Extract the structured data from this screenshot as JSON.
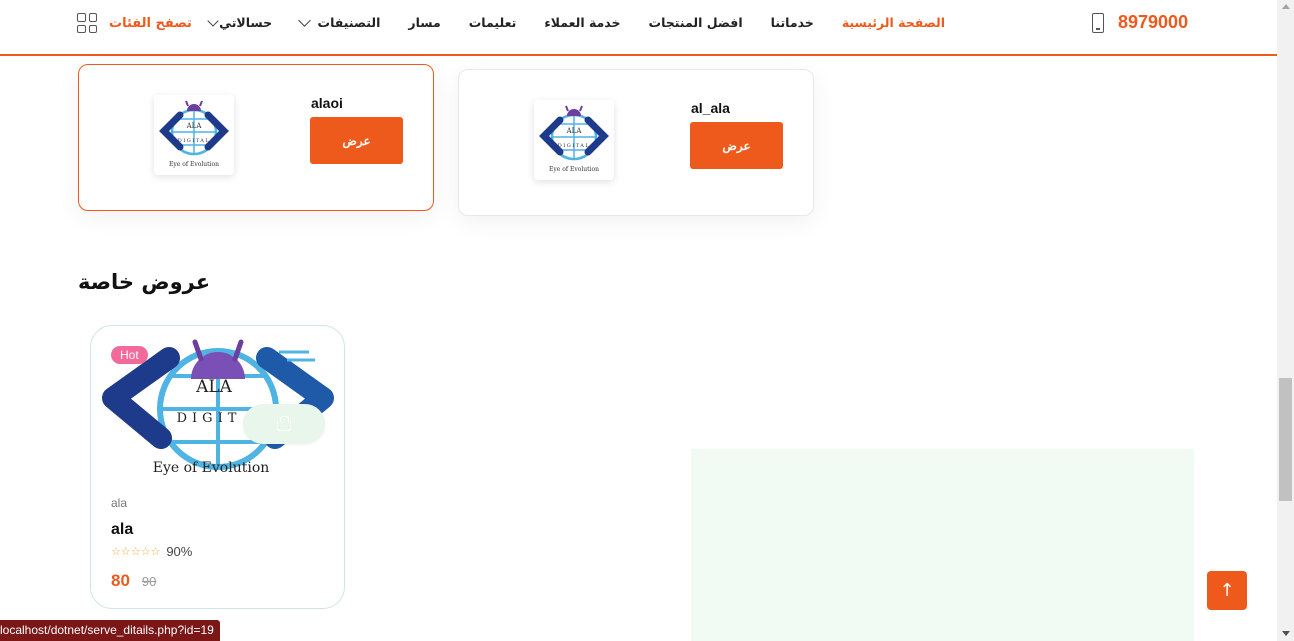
{
  "header": {
    "phone": "8979000",
    "nav": [
      {
        "label": "الصفحة الرئيسية",
        "active": true,
        "dropdown": false
      },
      {
        "label": "خدماتنا",
        "active": false,
        "dropdown": false
      },
      {
        "label": "افضل المنتجات",
        "active": false,
        "dropdown": false
      },
      {
        "label": "خدمة العملاء",
        "active": false,
        "dropdown": false
      },
      {
        "label": "تعليمات",
        "active": false,
        "dropdown": false
      },
      {
        "label": "مسار",
        "active": false,
        "dropdown": false
      },
      {
        "label": "التصنيفات",
        "active": false,
        "dropdown": true
      },
      {
        "label": "حسالاتي",
        "active": false,
        "dropdown": true
      }
    ],
    "browse_label": "تصفح الفئات",
    "accent_color": "#ee5a1c"
  },
  "products": [
    {
      "name": "alaoi",
      "button_label": "عرض",
      "selected": true
    },
    {
      "name": "al_ala",
      "button_label": "عرض",
      "selected": false
    }
  ],
  "logo": {
    "line1": "ALA",
    "line2": "DIGIT",
    "tagline": "Eye of Evolution",
    "thumb_line2": "DIGITAL"
  },
  "special_offers": {
    "title": "عروض خاصة",
    "items": [
      {
        "badge": "Hot",
        "category": "ala",
        "name": "ala",
        "rating": "90%",
        "stars": "☆☆☆☆☆",
        "price": "80",
        "old_price": "90"
      }
    ]
  },
  "back_to_top_icon": "arrow-up-icon",
  "status_url": "localhost/dotnet/serve_ditails.php?id=19"
}
